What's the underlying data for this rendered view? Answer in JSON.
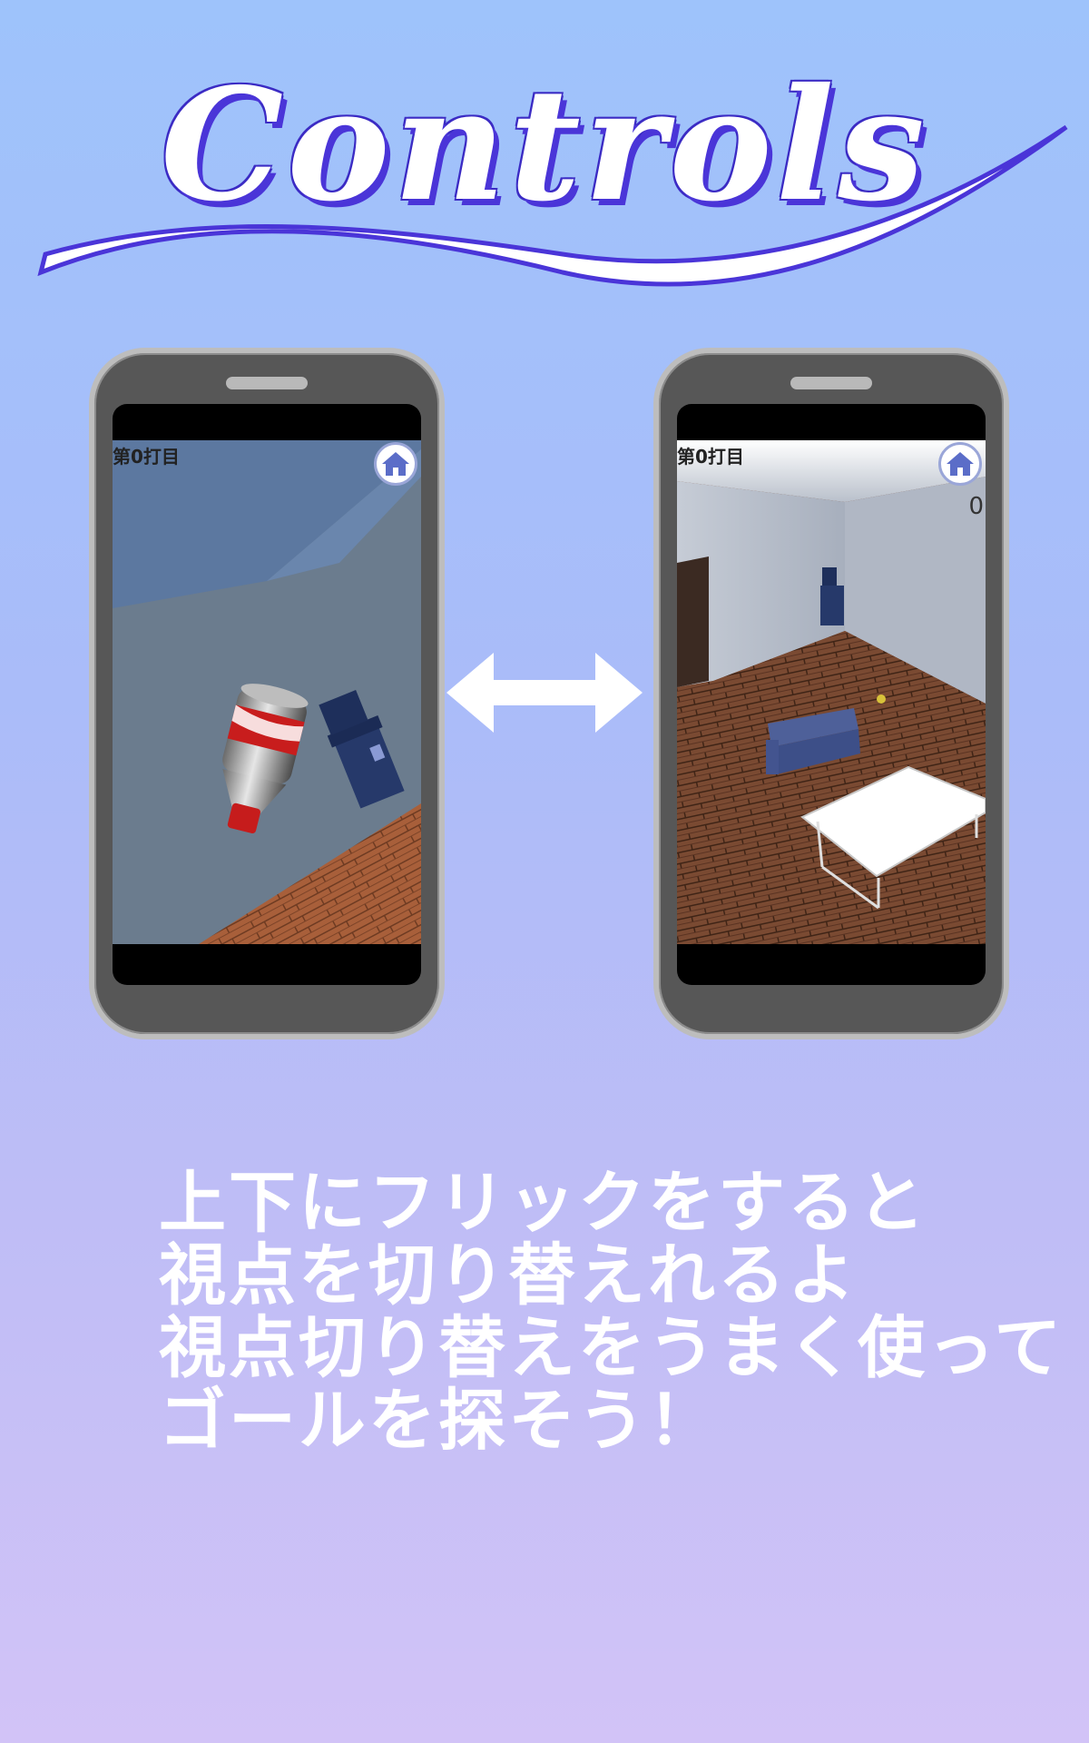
{
  "title": "Controls",
  "phones": [
    {
      "hud_label": "第0打目",
      "icons": [
        "home-icon"
      ]
    },
    {
      "hud_label": "第0打目",
      "score": "0",
      "icons": [
        "home-icon"
      ]
    }
  ],
  "arrow_icon": "double-arrow-icon",
  "caption": {
    "line1": "上下にフリックをすると",
    "line2": "視点を切り替えれるよ",
    "line3": "視点切り替えをうまく使って",
    "line4": "ゴールを探そう！"
  },
  "colors": {
    "title_outline": "#4a35d8",
    "background_top": "#9ec3fb",
    "background_bottom": "#d2c3f7",
    "phone_body": "#575757"
  }
}
